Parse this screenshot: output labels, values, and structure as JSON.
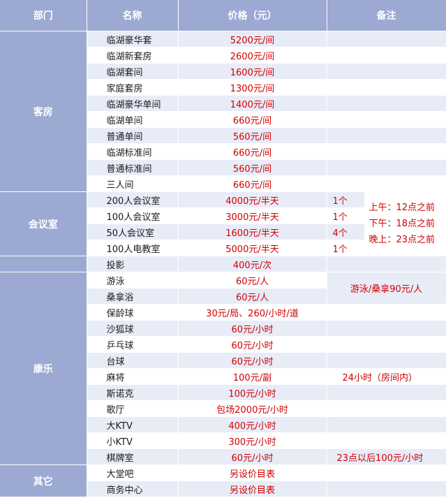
{
  "header": {
    "dept": "部门",
    "name": "名称",
    "price": "价格（元）",
    "remark": "备注"
  },
  "groups": {
    "guest": "客房",
    "meeting": "会议室",
    "recreation": "康乐",
    "other": "其它"
  },
  "rows": [
    {
      "name": "临湖豪华套",
      "price": "5200元/间",
      "remark": ""
    },
    {
      "name": "临湖新套房",
      "price": "2600元/间",
      "remark": ""
    },
    {
      "name": "临湖套间",
      "price": "1600元/间",
      "remark": ""
    },
    {
      "name": "家庭套房",
      "price": "1300元/间",
      "remark": ""
    },
    {
      "name": "临湖豪华单间",
      "price": "1400元/间",
      "remark": ""
    },
    {
      "name": "临湖单间",
      "price": "660元/间",
      "remark": ""
    },
    {
      "name": "普通单间",
      "price": "560元/间",
      "remark": ""
    },
    {
      "name": "临湖标准间",
      "price": "660元/间",
      "remark": ""
    },
    {
      "name": "普通标准间",
      "price": "560元/间",
      "remark": ""
    },
    {
      "name": "三人间",
      "price": "660元/间",
      "remark": ""
    },
    {
      "name": "200人会议室",
      "price": "4000元/半天",
      "remark": "1个"
    },
    {
      "name": "100人会议室",
      "price": "3000元/半天",
      "remark": "1个"
    },
    {
      "name": "50人会议室",
      "price": "1600元/半天",
      "remark": "4个"
    },
    {
      "name": "100人电教室",
      "price": "5000元/半天",
      "remark": "1个"
    },
    {
      "name": "投影",
      "price": "400元/次",
      "remark": ""
    },
    {
      "name": "游泳",
      "price": "60元/人",
      "remark": ""
    },
    {
      "name": "桑拿浴",
      "price": "60元/人",
      "remark": ""
    },
    {
      "name": "保龄球",
      "price": "30元/局、260/小时/道",
      "remark": ""
    },
    {
      "name": "沙狐球",
      "price": "60元/小时",
      "remark": ""
    },
    {
      "name": "乒乓球",
      "price": "60元/小时",
      "remark": ""
    },
    {
      "name": "台球",
      "price": "60元/小时",
      "remark": ""
    },
    {
      "name": "麻将",
      "price": "100元/副",
      "remark": "24小时（房间内）"
    },
    {
      "name": "斯诺克",
      "price": "100元/小时",
      "remark": ""
    },
    {
      "name": "歌厅",
      "price": "包场2000元/小时",
      "remark": ""
    },
    {
      "name": "大KTV",
      "price": "400元/小时",
      "remark": ""
    },
    {
      "name": "小KTV",
      "price": "300元/小时",
      "remark": ""
    },
    {
      "name": "棋牌室",
      "price": "60元/小时",
      "remark": "23点以后100元/小时"
    },
    {
      "name": "大堂吧",
      "price": "另设价目表",
      "remark": ""
    },
    {
      "name": "商务中心",
      "price": "另设价目表",
      "remark": ""
    }
  ],
  "notes": {
    "meeting_hours": [
      "上午：12点之前",
      "下午：18点之前",
      "晚上：23点之前"
    ],
    "swim_sauna": "游泳/桑拿90元/人"
  },
  "colors": {
    "header_bg": "#9ca9d2",
    "row_alt": "#e8ecf7",
    "price_text": "#d00000"
  }
}
